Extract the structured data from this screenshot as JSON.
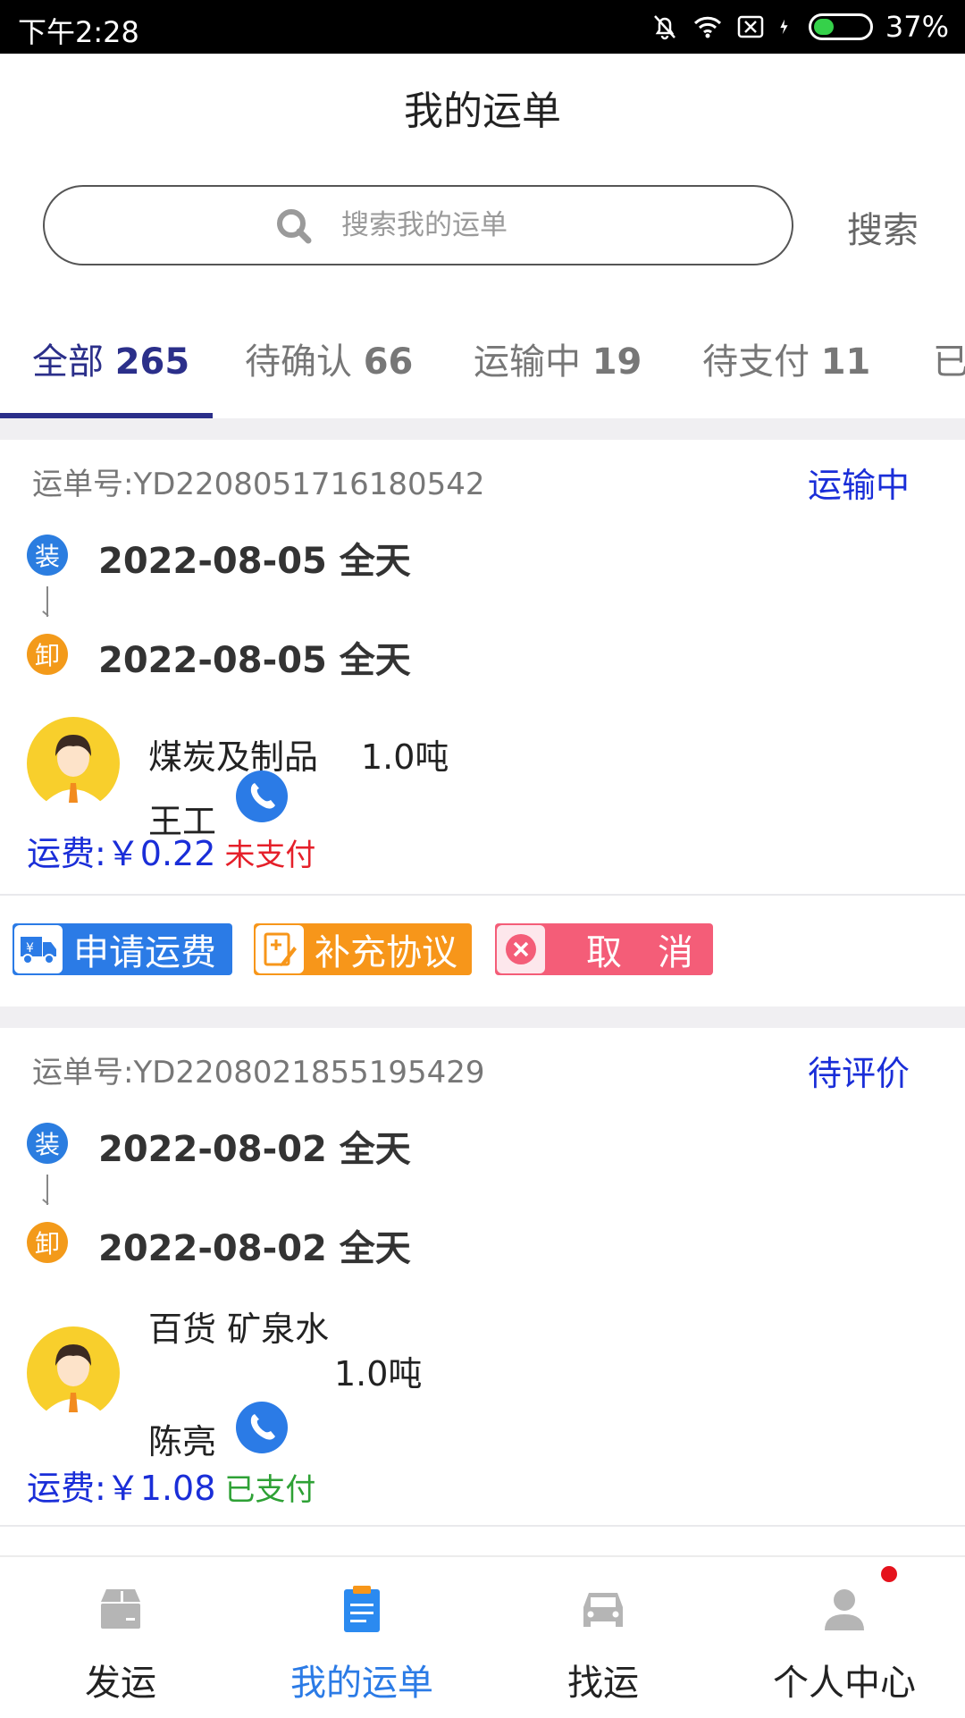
{
  "status_bar": {
    "time": "下午2:28",
    "battery": "37%",
    "battery_level": 0.37
  },
  "header": {
    "title": "我的运单"
  },
  "search": {
    "placeholder": "搜索我的运单",
    "button": "搜索"
  },
  "tabs": [
    {
      "label": "全部",
      "count": "265",
      "active": true
    },
    {
      "label": "待确认",
      "count": "66",
      "active": false
    },
    {
      "label": "运输中",
      "count": "19",
      "active": false
    },
    {
      "label": "待支付",
      "count": "11",
      "active": false
    },
    {
      "label": "已",
      "count": "",
      "active": false
    }
  ],
  "orders": [
    {
      "order_no": "运单号:YD2208051716180542",
      "status": "运输中",
      "load_badge": "装",
      "unload_badge": "卸",
      "load_date": "2022-08-05  全天",
      "unload_date": "2022-08-05  全天",
      "goods": "煤炭及制品",
      "weight": "1.0吨",
      "contact": "王工",
      "fee": "运费:￥0.22",
      "pay_state": "未支付",
      "actions": [
        "申请运费",
        "补充协议",
        "取　消"
      ]
    },
    {
      "order_no": "运单号:YD2208021855195429",
      "status": "待评价",
      "load_badge": "装",
      "unload_badge": "卸",
      "load_date": "2022-08-02  全天",
      "unload_date": "2022-08-02  全天",
      "goods": "百货  矿泉水",
      "weight": "1.0吨",
      "contact": "陈亮",
      "fee": "运费:￥1.08",
      "pay_state": "已支付"
    }
  ],
  "bottom_nav": [
    {
      "label": "发运",
      "icon": "box-icon"
    },
    {
      "label": "我的运单",
      "icon": "clipboard-icon",
      "active": true
    },
    {
      "label": "找运",
      "icon": "car-icon"
    },
    {
      "label": "个人中心",
      "icon": "person-icon"
    }
  ],
  "colors": {
    "accent": "#2b2f8a",
    "link_blue": "#1a2ed8",
    "unpaid": "#e5202a",
    "paid": "#2ea135"
  }
}
